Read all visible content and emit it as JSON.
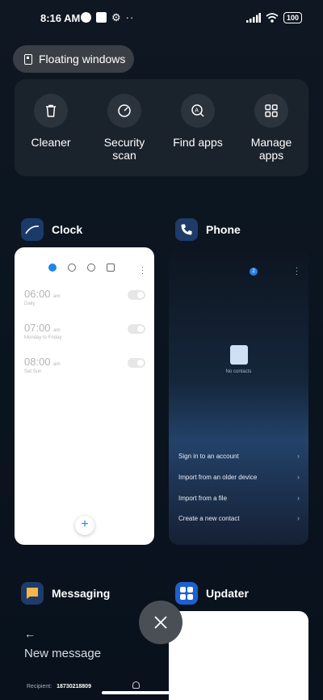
{
  "status_bar": {
    "time": "8:16 AM",
    "battery": "100"
  },
  "floating_windows": {
    "label": "Floating windows"
  },
  "quick_actions": [
    {
      "label_line1": "Cleaner",
      "label_line2": "",
      "icon": "trash-icon"
    },
    {
      "label_line1": "Security",
      "label_line2": "scan",
      "icon": "security-scan-icon"
    },
    {
      "label_line1": "Find apps",
      "label_line2": "",
      "icon": "find-apps-icon"
    },
    {
      "label_line1": "Manage",
      "label_line2": "apps",
      "icon": "manage-apps-icon"
    }
  ],
  "apps": {
    "clock": {
      "title": "Clock",
      "alarms": [
        {
          "time": "06:00",
          "ampm": "am",
          "repeat": "Daily"
        },
        {
          "time": "07:00",
          "ampm": "am",
          "repeat": "Monday to Friday"
        },
        {
          "time": "08:00",
          "ampm": "am",
          "repeat": "Sat Sun"
        }
      ],
      "fab": "+"
    },
    "phone": {
      "title": "Phone",
      "badge": "2",
      "empty_text": "No contacts",
      "options": [
        "Sign in to an account",
        "Import from an older device",
        "Import from a file",
        "Create a new contact"
      ]
    },
    "messaging": {
      "title": "Messaging",
      "back": "←",
      "heading": "New message",
      "recipient_label": "Recipient:",
      "recipient_value": "18730218809"
    },
    "updater": {
      "title": "Updater"
    }
  },
  "colors": {
    "background": "#0d1620",
    "accent_blue": "#1e88e5",
    "panel": "#1a222c"
  }
}
